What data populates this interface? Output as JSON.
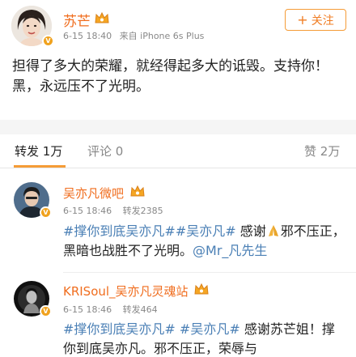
{
  "post": {
    "author": "苏芒",
    "date": "6-15 18:40",
    "source": "来自 iPhone 6s Plus",
    "follow_label": "关注",
    "content": "担得了多大的荣耀，就经得起多大的诋毁。支持你！黑，永远压不了光明。"
  },
  "tabs": {
    "repost_label": "转发",
    "repost_count": "1万",
    "comment_label": "评论",
    "comment_count": "0",
    "like_label": "赞",
    "like_count": "2万"
  },
  "comments": [
    {
      "author": "吴亦凡微吧",
      "date": "6-15 18:46",
      "reposts": "转发2385",
      "tag1": "#撑你到底吴亦凡#",
      "tag2": "#吴亦凡#",
      "text_a": "感谢",
      "text_b": "邪不压正，黑暗也战胜不了光明。",
      "mention": "@Mr_凡先生"
    },
    {
      "author": "KRISoul_吴亦凡灵魂站",
      "date": "6-15 18:46",
      "reposts": "转发464",
      "tag1": "#撑你到底吴亦凡#",
      "tag2": "#吴亦凡#",
      "text": "感谢苏芒姐！撑你到底吴亦凡。邪不压正，荣辱与"
    }
  ],
  "colors": {
    "name_orange": "#f06d1e",
    "link_blue": "#4a7fb5",
    "follow_border": "#f59c37",
    "verified_badge": "#f0a21e",
    "background": "#f5f5f5"
  },
  "icons": [
    "avatar-photo",
    "verified-badge-icon",
    "vip-crown-icon",
    "plus-icon",
    "praying-hands-emoji"
  ]
}
